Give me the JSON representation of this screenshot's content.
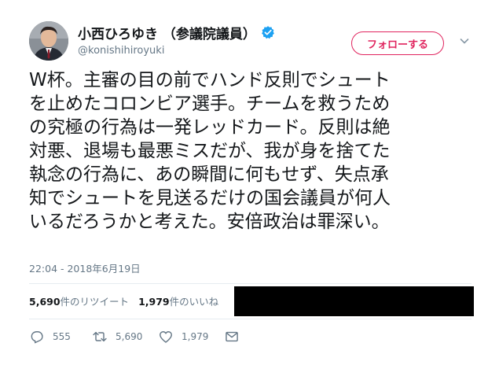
{
  "user": {
    "display_name": "小西ひろゆき （参議院議員）",
    "handle": "@konishihiroyuki",
    "verified_color": "#1da1f2"
  },
  "follow_button": {
    "label": "フォローする",
    "color": "#e0245e"
  },
  "tweet": {
    "lines": [
      "W杯。主審の目の前でハンド反則でシュート",
      "を止めたコロンビア選手。チームを救うため",
      "の究極の行為は一発レッドカード。反則は絶",
      "対悪、退場も最悪ミスだが、我が身を捨てた",
      "執念の行為に、あの瞬間に何もせず、失点承",
      "知でシュートを見送るだけの国会議員が何人",
      "いるだろうかと考えた。安倍政治は罪深い。"
    ],
    "timestamp": "22:04 - 2018年6月19日"
  },
  "stats": {
    "retweets_count": "5,690",
    "retweets_label": "件のリツイート",
    "likes_count": "1,979",
    "likes_label": "件のいいね"
  },
  "actions": {
    "reply_count": "555",
    "retweet_count": "5,690",
    "like_count": "1,979"
  },
  "icons": {
    "reply": "reply-icon",
    "retweet": "retweet-icon",
    "like": "heart-icon",
    "message": "envelope-icon",
    "more": "chevron-down-icon",
    "verified": "verified-badge-icon"
  }
}
